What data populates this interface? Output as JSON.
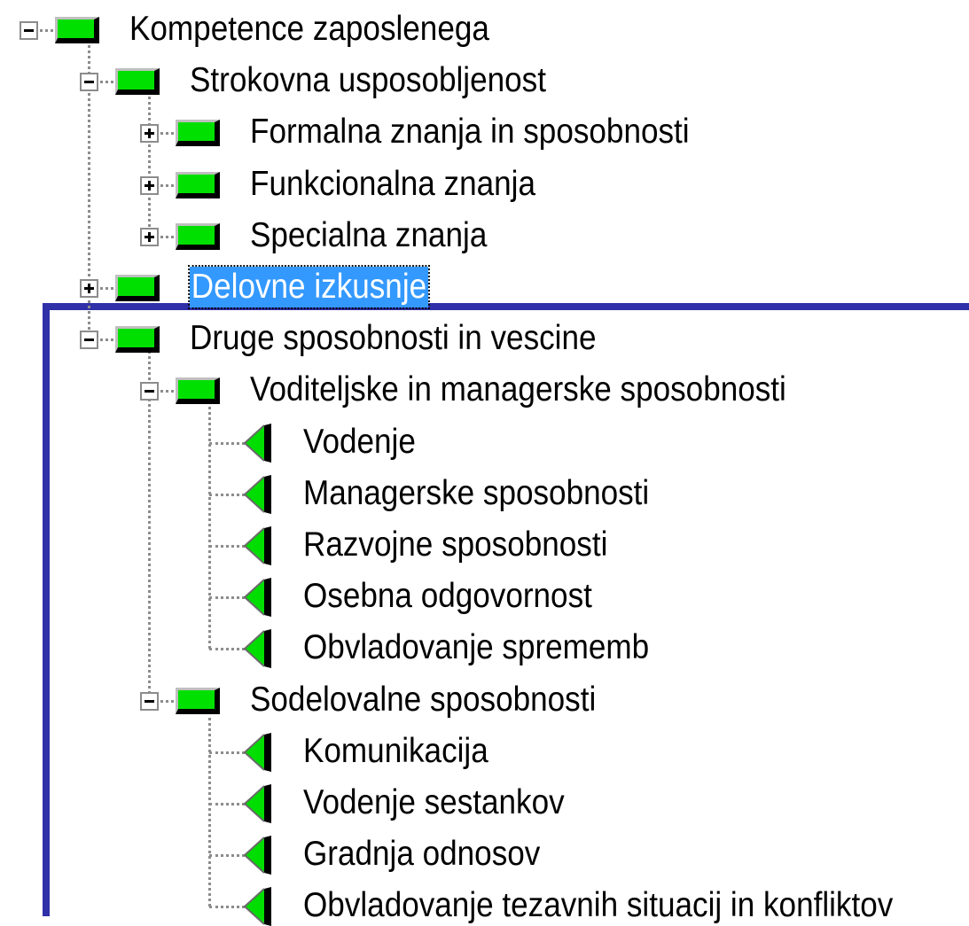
{
  "tree": {
    "selected_node": "Delovne izkusnje",
    "selected_background": "#3399ff",
    "selected_text_color": "#ffffff",
    "folder_icon_color": "#00e000",
    "leaf_icon_color": "#00dd00",
    "frame_color": "#3030a8",
    "nodes": [
      {
        "label": "Kompetence zaposlenega",
        "level": 0,
        "kind": "folder",
        "expander": "collapse",
        "selected": false,
        "icon": "green-folder-icon"
      },
      {
        "label": "Strokovna usposobljenost",
        "level": 1,
        "kind": "folder",
        "expander": "collapse",
        "selected": false,
        "icon": "green-folder-icon"
      },
      {
        "label": "Formalna znanja in sposobnosti",
        "level": 2,
        "kind": "folder",
        "expander": "expand",
        "selected": false,
        "icon": "green-folder-icon"
      },
      {
        "label": "Funkcionalna znanja",
        "level": 2,
        "kind": "folder",
        "expander": "expand",
        "selected": false,
        "icon": "green-folder-icon"
      },
      {
        "label": "Specialna znanja",
        "level": 2,
        "kind": "folder",
        "expander": "expand",
        "selected": false,
        "icon": "green-folder-icon"
      },
      {
        "label": "Delovne izkusnje",
        "level": 1,
        "kind": "folder",
        "expander": "expand",
        "selected": true,
        "icon": "green-folder-icon"
      },
      {
        "label": "Druge sposobnosti in vescine",
        "level": 1,
        "kind": "folder",
        "expander": "collapse",
        "selected": false,
        "icon": "green-folder-icon"
      },
      {
        "label": "Voditeljske in managerske sposobnosti",
        "level": 2,
        "kind": "folder",
        "expander": "collapse",
        "selected": false,
        "icon": "green-folder-icon"
      },
      {
        "label": "Vodenje",
        "level": 3,
        "kind": "leaf",
        "selected": false,
        "icon": "green-triangle-icon"
      },
      {
        "label": "Managerske sposobnosti",
        "level": 3,
        "kind": "leaf",
        "selected": false,
        "icon": "green-triangle-icon"
      },
      {
        "label": "Razvojne sposobnosti",
        "level": 3,
        "kind": "leaf",
        "selected": false,
        "icon": "green-triangle-icon"
      },
      {
        "label": "Osebna odgovornost",
        "level": 3,
        "kind": "leaf",
        "selected": false,
        "icon": "green-triangle-icon"
      },
      {
        "label": "Obvladovanje sprememb",
        "level": 3,
        "kind": "leaf",
        "selected": false,
        "icon": "green-triangle-icon"
      },
      {
        "label": "Sodelovalne sposobnosti",
        "level": 2,
        "kind": "folder",
        "expander": "collapse",
        "selected": false,
        "icon": "green-folder-icon"
      },
      {
        "label": "Komunikacija",
        "level": 3,
        "kind": "leaf",
        "selected": false,
        "icon": "green-triangle-icon"
      },
      {
        "label": "Vodenje sestankov",
        "level": 3,
        "kind": "leaf",
        "selected": false,
        "icon": "green-triangle-icon"
      },
      {
        "label": "Gradnja odnosov",
        "level": 3,
        "kind": "leaf",
        "selected": false,
        "icon": "green-triangle-icon"
      },
      {
        "label": "Obvladovanje tezavnih situacij in konfliktov",
        "level": 3,
        "kind": "leaf",
        "selected": false,
        "icon": "green-triangle-icon"
      }
    ]
  }
}
